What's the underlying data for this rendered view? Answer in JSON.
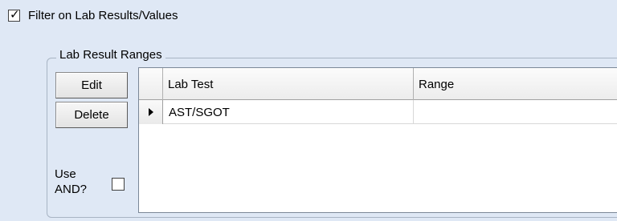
{
  "filter": {
    "checked": true,
    "label": "Filter on Lab Results/Values"
  },
  "lab_result_ranges": {
    "group_title": "Lab Result Ranges",
    "edit_label": "Edit",
    "delete_label": "Delete",
    "use_and_line1": "Use",
    "use_and_line2": "AND?",
    "use_and_checked": false
  },
  "grid": {
    "columns": [
      "Lab Test",
      "Range"
    ],
    "rows": [
      {
        "selected": true,
        "lab_test": "AST/SGOT",
        "range": ""
      }
    ]
  }
}
